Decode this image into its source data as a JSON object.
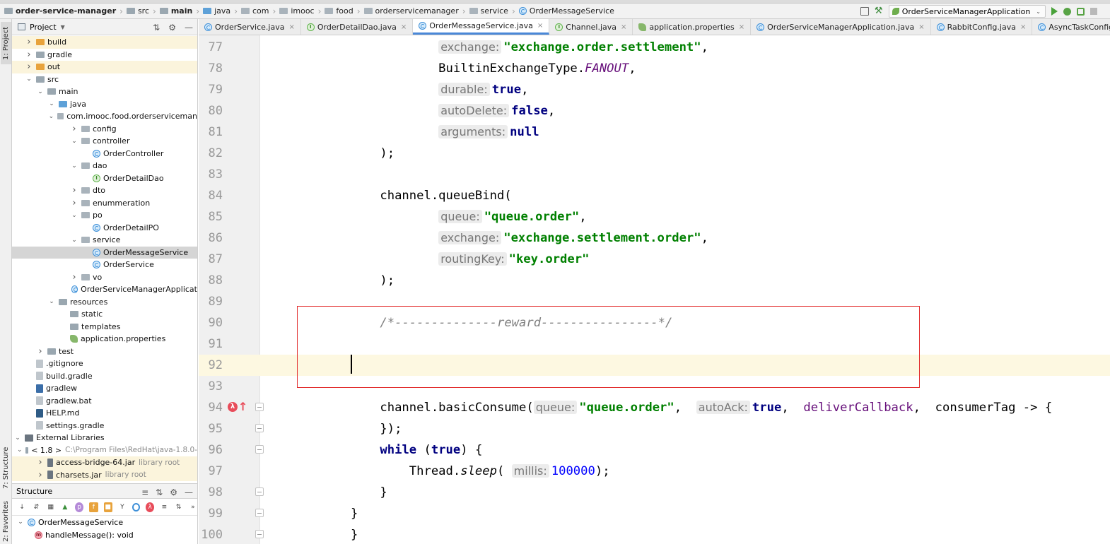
{
  "breadcrumb": [
    {
      "label": "order-service-manager",
      "icon": "folder",
      "bold": true
    },
    {
      "label": "src",
      "icon": "folder",
      "bold": false
    },
    {
      "label": "main",
      "icon": "folder",
      "bold": true
    },
    {
      "label": "java",
      "icon": "folder-blue",
      "bold": false
    },
    {
      "label": "com",
      "icon": "package",
      "bold": false
    },
    {
      "label": "imooc",
      "icon": "package",
      "bold": false
    },
    {
      "label": "food",
      "icon": "package",
      "bold": false
    },
    {
      "label": "orderservicemanager",
      "icon": "package",
      "bold": false
    },
    {
      "label": "service",
      "icon": "package",
      "bold": false
    },
    {
      "label": "OrderMessageService",
      "icon": "class",
      "bold": false
    }
  ],
  "run_config": {
    "label": "OrderServiceManagerApplication"
  },
  "tool_windows": {
    "project": "1: Project",
    "structure": "7: Structure",
    "favorites": "2: Favorites"
  },
  "project_panel": {
    "title": "Project",
    "tree": [
      {
        "label": "build",
        "icon": "folder-orange",
        "level": 1,
        "chevron": "right",
        "highlight": true
      },
      {
        "label": "gradle",
        "icon": "folder",
        "level": 1,
        "chevron": "right"
      },
      {
        "label": "out",
        "icon": "folder-orange",
        "level": 1,
        "chevron": "right",
        "highlight": true
      },
      {
        "label": "src",
        "icon": "folder",
        "level": 1,
        "chevron": "down"
      },
      {
        "label": "main",
        "icon": "folder",
        "level": 2,
        "chevron": "down"
      },
      {
        "label": "java",
        "icon": "folder-blue",
        "level": 3,
        "chevron": "down"
      },
      {
        "label": "com.imooc.food.orderserviceman",
        "icon": "package",
        "level": 4,
        "chevron": "down"
      },
      {
        "label": "config",
        "icon": "package",
        "level": 5,
        "chevron": "right"
      },
      {
        "label": "controller",
        "icon": "package",
        "level": 5,
        "chevron": "down"
      },
      {
        "label": "OrderController",
        "icon": "class",
        "level": 6
      },
      {
        "label": "dao",
        "icon": "package",
        "level": 5,
        "chevron": "down"
      },
      {
        "label": "OrderDetailDao",
        "icon": "interface",
        "level": 6
      },
      {
        "label": "dto",
        "icon": "package",
        "level": 5,
        "chevron": "right"
      },
      {
        "label": "enummeration",
        "icon": "package",
        "level": 5,
        "chevron": "right"
      },
      {
        "label": "po",
        "icon": "package",
        "level": 5,
        "chevron": "down"
      },
      {
        "label": "OrderDetailPO",
        "icon": "class",
        "level": 6
      },
      {
        "label": "service",
        "icon": "package",
        "level": 5,
        "chevron": "down"
      },
      {
        "label": "OrderMessageService",
        "icon": "class",
        "level": 6,
        "selected": true
      },
      {
        "label": "OrderService",
        "icon": "class",
        "level": 6
      },
      {
        "label": "vo",
        "icon": "package",
        "level": 5,
        "chevron": "right"
      },
      {
        "label": "OrderServiceManagerApplicat",
        "icon": "class",
        "level": 5
      },
      {
        "label": "resources",
        "icon": "folder",
        "level": 3,
        "chevron": "down"
      },
      {
        "label": "static",
        "icon": "folder",
        "level": 4
      },
      {
        "label": "templates",
        "icon": "folder",
        "level": 4
      },
      {
        "label": "application.properties",
        "icon": "properties",
        "level": 4
      },
      {
        "label": "test",
        "icon": "folder",
        "level": 2,
        "chevron": "right"
      },
      {
        "label": ".gitignore",
        "icon": "file",
        "level": 1
      },
      {
        "label": "build.gradle",
        "icon": "file",
        "level": 1
      },
      {
        "label": "gradlew",
        "icon": "terminal",
        "level": 1
      },
      {
        "label": "gradlew.bat",
        "icon": "file",
        "level": 1
      },
      {
        "label": "HELP.md",
        "icon": "markdown",
        "level": 1
      },
      {
        "label": "settings.gradle",
        "icon": "file",
        "level": 1
      },
      {
        "label": "External Libraries",
        "icon": "library",
        "level": 0,
        "chevron": "down"
      },
      {
        "label": "< 1.8 >",
        "icon": "folder",
        "level": 1,
        "chevron": "down",
        "extra": "C:\\Program Files\\RedHat\\java-1.8.0-"
      },
      {
        "label": "access-bridge-64.jar",
        "icon": "jar",
        "level": 2,
        "chevron": "right",
        "extra": "library root",
        "highlight": true
      },
      {
        "label": "charsets.jar",
        "icon": "jar",
        "level": 2,
        "chevron": "right",
        "extra": "library root",
        "highlight": true
      }
    ]
  },
  "structure_panel": {
    "title": "Structure",
    "items": [
      {
        "label": "OrderMessageService",
        "icon": "class",
        "level": 0
      },
      {
        "label": "handleMessage(): void",
        "icon": "method",
        "level": 1
      }
    ]
  },
  "editor_tabs": [
    {
      "label": "OrderService.java",
      "icon": "class",
      "active": false
    },
    {
      "label": "OrderDetailDao.java",
      "icon": "interface",
      "active": false
    },
    {
      "label": "OrderMessageService.java",
      "icon": "class",
      "active": true
    },
    {
      "label": "Channel.java",
      "icon": "interface",
      "active": false
    },
    {
      "label": "application.properties",
      "icon": "properties",
      "active": false
    },
    {
      "label": "OrderServiceManagerApplication.java",
      "icon": "class",
      "active": false
    },
    {
      "label": "RabbitConfig.java",
      "icon": "class",
      "active": false
    },
    {
      "label": "AsyncTaskConfig.java",
      "icon": "class",
      "active": false
    }
  ],
  "editor": {
    "lines": [
      {
        "n": "77",
        "code": [
          [
            "            ",
            ""
          ],
          [
            "exchange:",
            "hint"
          ],
          [
            "\"exchange.order.settlement\"",
            "str"
          ],
          [
            ",",
            ""
          ]
        ]
      },
      {
        "n": "78",
        "code": [
          [
            "            BuiltinExchangeType.",
            ""
          ],
          [
            "FANOUT",
            "field"
          ],
          [
            ",",
            ""
          ]
        ]
      },
      {
        "n": "79",
        "code": [
          [
            "            ",
            ""
          ],
          [
            "durable:",
            "hint"
          ],
          [
            "true",
            "kw"
          ],
          [
            ",",
            ""
          ]
        ]
      },
      {
        "n": "80",
        "code": [
          [
            "            ",
            ""
          ],
          [
            "autoDelete:",
            "hint"
          ],
          [
            "false",
            "kw"
          ],
          [
            ",",
            ""
          ]
        ]
      },
      {
        "n": "81",
        "code": [
          [
            "            ",
            ""
          ],
          [
            "arguments:",
            "hint"
          ],
          [
            "null",
            "kw"
          ]
        ]
      },
      {
        "n": "82",
        "code": [
          [
            "    );",
            ""
          ]
        ]
      },
      {
        "n": "83",
        "code": []
      },
      {
        "n": "84",
        "code": [
          [
            "    channel.queueBind(",
            ""
          ]
        ]
      },
      {
        "n": "85",
        "code": [
          [
            "            ",
            ""
          ],
          [
            "queue:",
            "hint"
          ],
          [
            "\"queue.order\"",
            "str"
          ],
          [
            ",",
            ""
          ]
        ]
      },
      {
        "n": "86",
        "code": [
          [
            "            ",
            ""
          ],
          [
            "exchange:",
            "hint"
          ],
          [
            "\"exchange.settlement.order\"",
            "str"
          ],
          [
            ",",
            ""
          ]
        ]
      },
      {
        "n": "87",
        "code": [
          [
            "            ",
            ""
          ],
          [
            "routingKey:",
            "hint"
          ],
          [
            "\"key.order\"",
            "str"
          ]
        ]
      },
      {
        "n": "88",
        "code": [
          [
            "    );",
            ""
          ]
        ]
      },
      {
        "n": "89",
        "code": []
      },
      {
        "n": "90",
        "code": [
          [
            "    ",
            ""
          ],
          [
            "/*--------------reward----------------*/",
            "cmt"
          ]
        ]
      },
      {
        "n": "91",
        "code": []
      },
      {
        "n": "92",
        "code": []
      },
      {
        "n": "93",
        "code": []
      },
      {
        "n": "94",
        "code": [
          [
            "    channel.basicConsume(",
            ""
          ],
          [
            "queue:",
            "hint"
          ],
          [
            "\"queue.order\"",
            "str"
          ],
          [
            ",  ",
            ""
          ],
          [
            "autoAck:",
            "hint"
          ],
          [
            "true",
            "kw"
          ],
          [
            ",  ",
            ""
          ],
          [
            "deliverCallback",
            "param"
          ],
          [
            ",  consumerTag -> {",
            ""
          ]
        ]
      },
      {
        "n": "95",
        "code": [
          [
            "    });",
            ""
          ]
        ]
      },
      {
        "n": "96",
        "code": [
          [
            "    ",
            ""
          ],
          [
            "while",
            "kw"
          ],
          [
            " (",
            ""
          ],
          [
            "true",
            "kw"
          ],
          [
            ") {",
            ""
          ]
        ]
      },
      {
        "n": "97",
        "code": [
          [
            "        Thread.",
            ""
          ],
          [
            "sleep",
            "italic"
          ],
          [
            "( ",
            ""
          ],
          [
            "millis:",
            "hint"
          ],
          [
            "100000",
            "num"
          ],
          [
            ");",
            ""
          ]
        ]
      },
      {
        "n": "98",
        "code": [
          [
            "    }",
            ""
          ]
        ]
      },
      {
        "n": "99",
        "code": [
          [
            "}",
            ""
          ]
        ]
      },
      {
        "n": "100",
        "code": [
          [
            "}",
            ""
          ]
        ]
      }
    ]
  }
}
